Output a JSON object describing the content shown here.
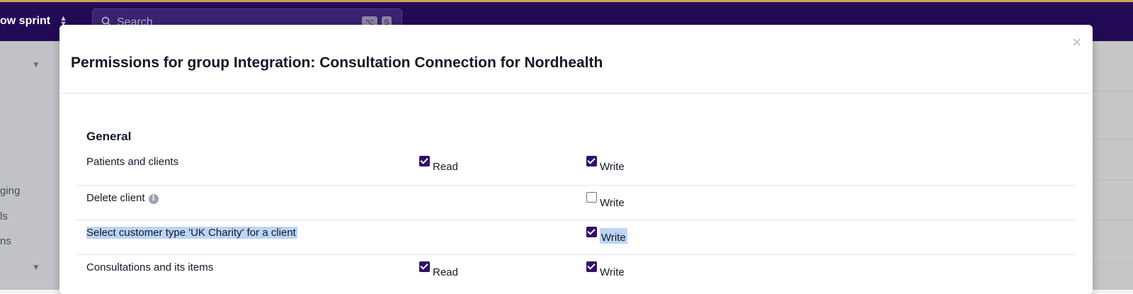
{
  "topbar": {
    "sprint_label": "ow sprint",
    "search_placeholder": "Search",
    "shortcut_keys": [
      "⌥",
      "S"
    ]
  },
  "sidebar": {
    "items": [
      "ging",
      "ls",
      "ns"
    ]
  },
  "modal": {
    "title": "Permissions for group Integration: Consultation Connection for Nordhealth",
    "close_label": "×",
    "section_title": "General",
    "read_label": "Read",
    "write_label": "Write",
    "rows": [
      {
        "label": "Patients and clients",
        "read": true,
        "write": true,
        "has_read": true
      },
      {
        "label": "Delete client",
        "info": true,
        "has_read": false,
        "write": false
      },
      {
        "label": "Select customer type 'UK Charity' for a client",
        "has_read": false,
        "write": true,
        "highlighted": true
      },
      {
        "label": "Consultations and its items",
        "read": true,
        "write": true,
        "has_read": true
      }
    ]
  },
  "colors": {
    "topbar": "#230a55",
    "checkbox_checked": "#2f0f6b",
    "selection_highlight": "#bcd5f5"
  }
}
